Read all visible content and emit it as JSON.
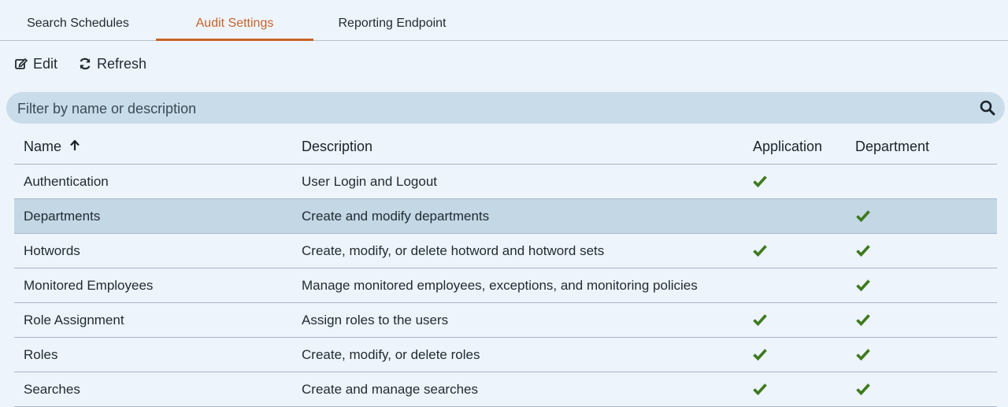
{
  "tabs": [
    {
      "label": "Search Schedules",
      "active": false
    },
    {
      "label": "Audit Settings",
      "active": true
    },
    {
      "label": "Reporting Endpoint",
      "active": false
    }
  ],
  "toolbar": {
    "edit_label": "Edit",
    "refresh_label": "Refresh"
  },
  "filter": {
    "placeholder": "Filter by name or description",
    "value": ""
  },
  "table": {
    "columns": [
      "Name",
      "Description",
      "Application",
      "Department"
    ],
    "sort": {
      "column": "Name",
      "direction": "ascending"
    },
    "rows": [
      {
        "name": "Authentication",
        "description": "User Login and Logout",
        "application": true,
        "department": false,
        "selected": false
      },
      {
        "name": "Departments",
        "description": "Create and modify departments",
        "application": false,
        "department": true,
        "selected": true
      },
      {
        "name": "Hotwords",
        "description": "Create, modify, or delete hotword and hotword sets",
        "application": true,
        "department": true,
        "selected": false
      },
      {
        "name": "Monitored Employees",
        "description": "Manage monitored employees, exceptions, and monitoring policies",
        "application": false,
        "department": true,
        "selected": false
      },
      {
        "name": "Role Assignment",
        "description": "Assign roles to the users",
        "application": true,
        "department": true,
        "selected": false
      },
      {
        "name": "Roles",
        "description": "Create, modify, or delete roles",
        "application": true,
        "department": true,
        "selected": false
      },
      {
        "name": "Searches",
        "description": "Create and manage searches",
        "application": true,
        "department": true,
        "selected": false
      }
    ]
  },
  "colors": {
    "accent": "#c8632a",
    "check": "#3d7a1e",
    "selected_row": "#c3d7e5",
    "background": "#eef4fc"
  },
  "icons": {
    "edit": "edit-icon",
    "refresh": "refresh-icon",
    "search": "search-icon",
    "sort": "arrow-up-icon",
    "check": "checkmark-icon"
  }
}
